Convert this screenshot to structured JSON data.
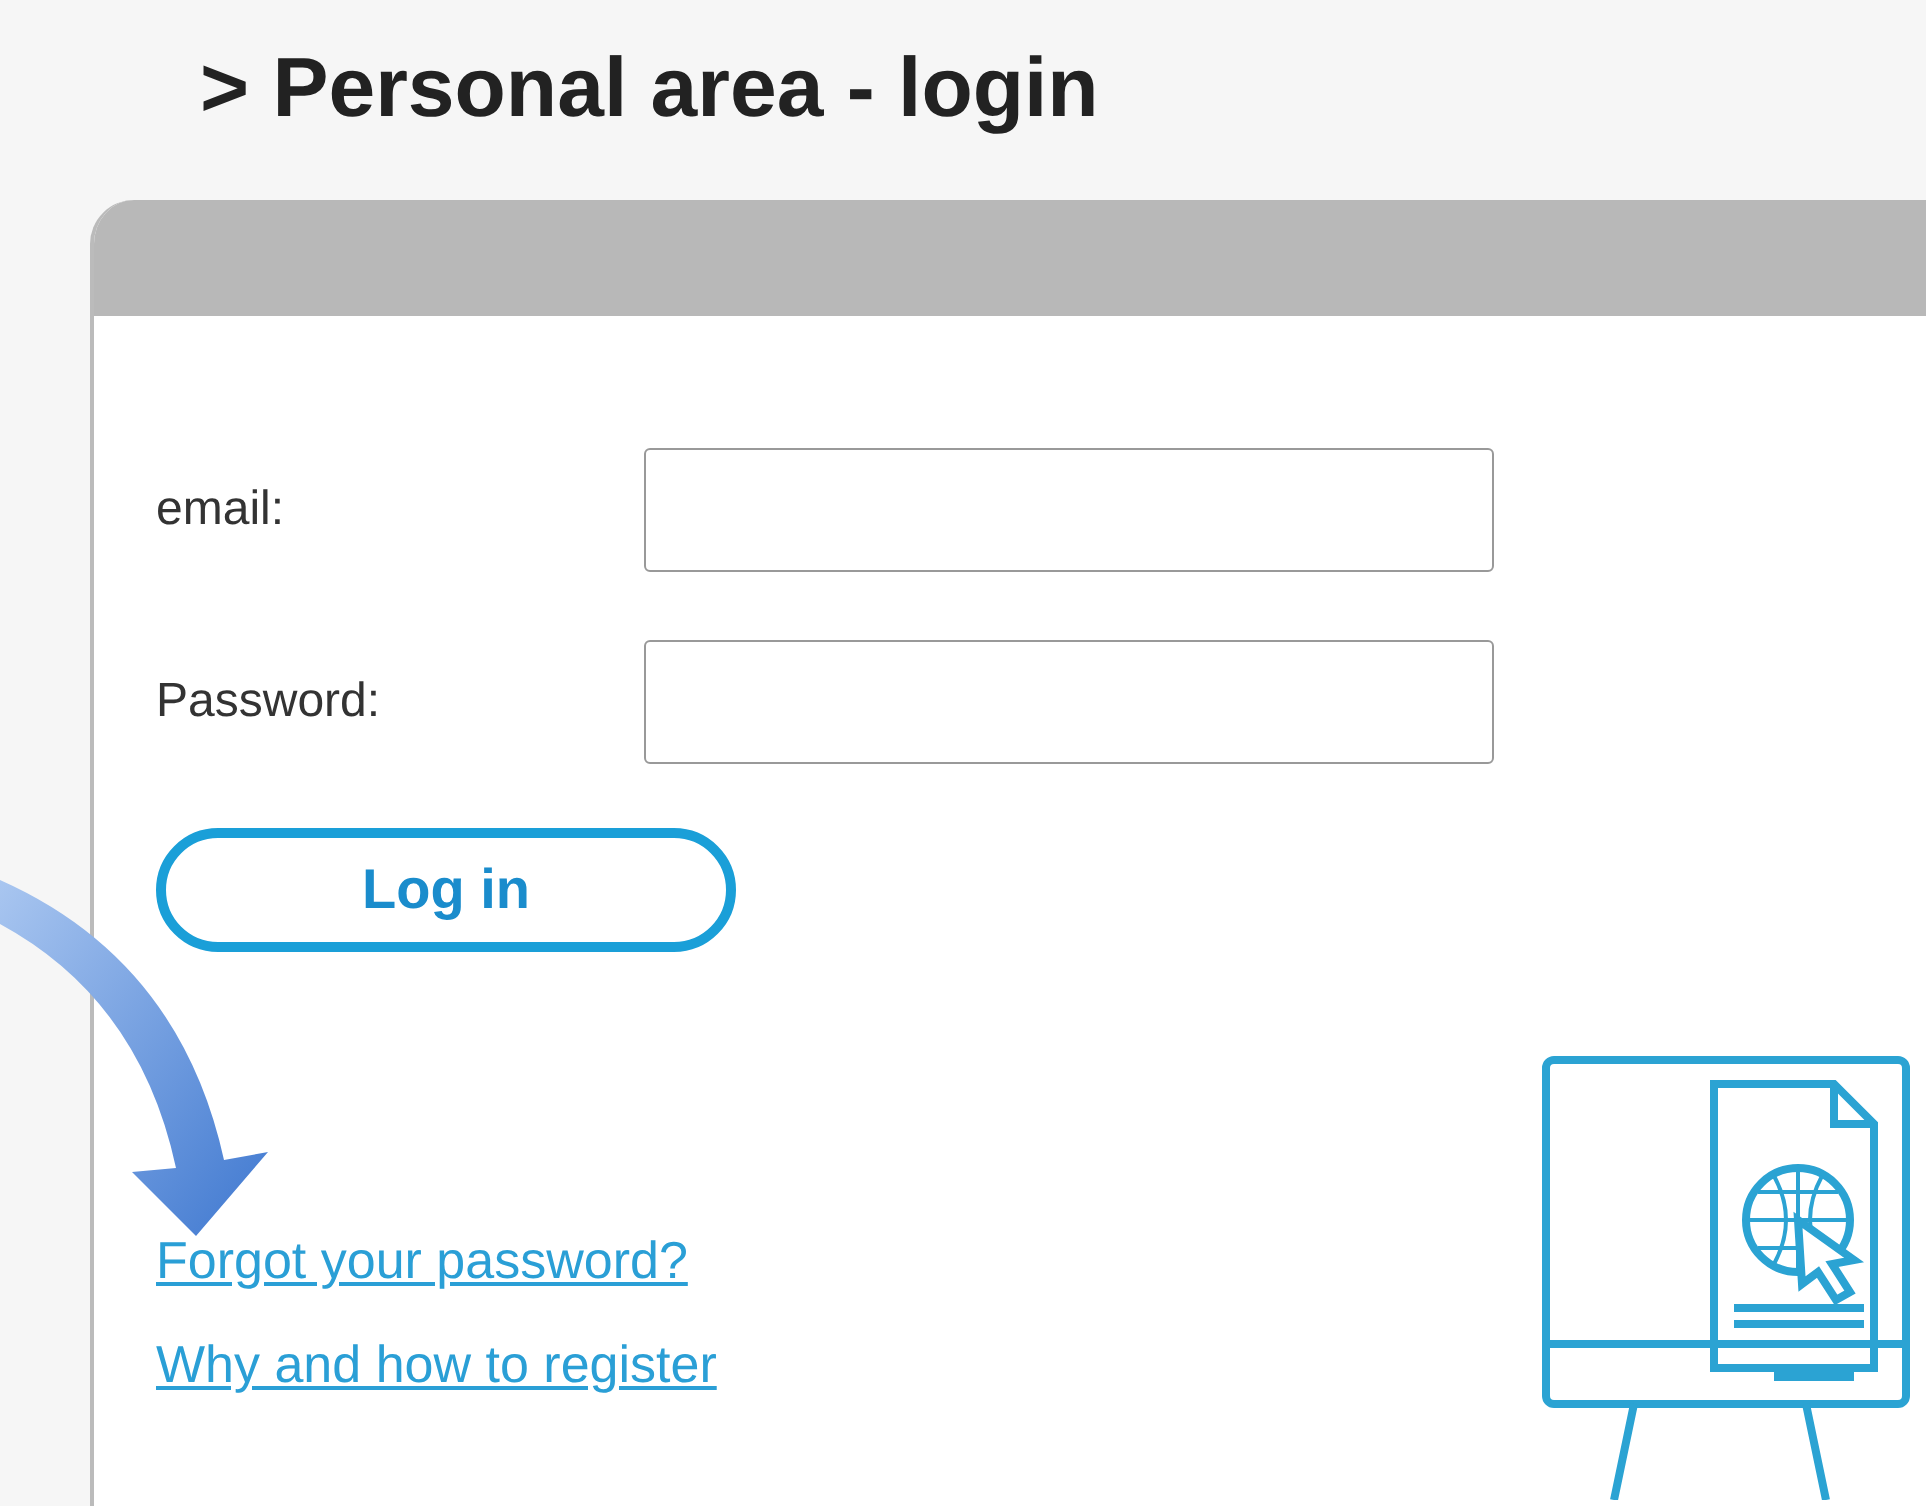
{
  "page_title": "> Personal area - login",
  "form": {
    "fields": [
      {
        "label": "email:"
      },
      {
        "label": "Password:"
      }
    ],
    "submit": "Log in"
  },
  "links": [
    "Forgot your password?",
    "Why and how to register"
  ]
}
